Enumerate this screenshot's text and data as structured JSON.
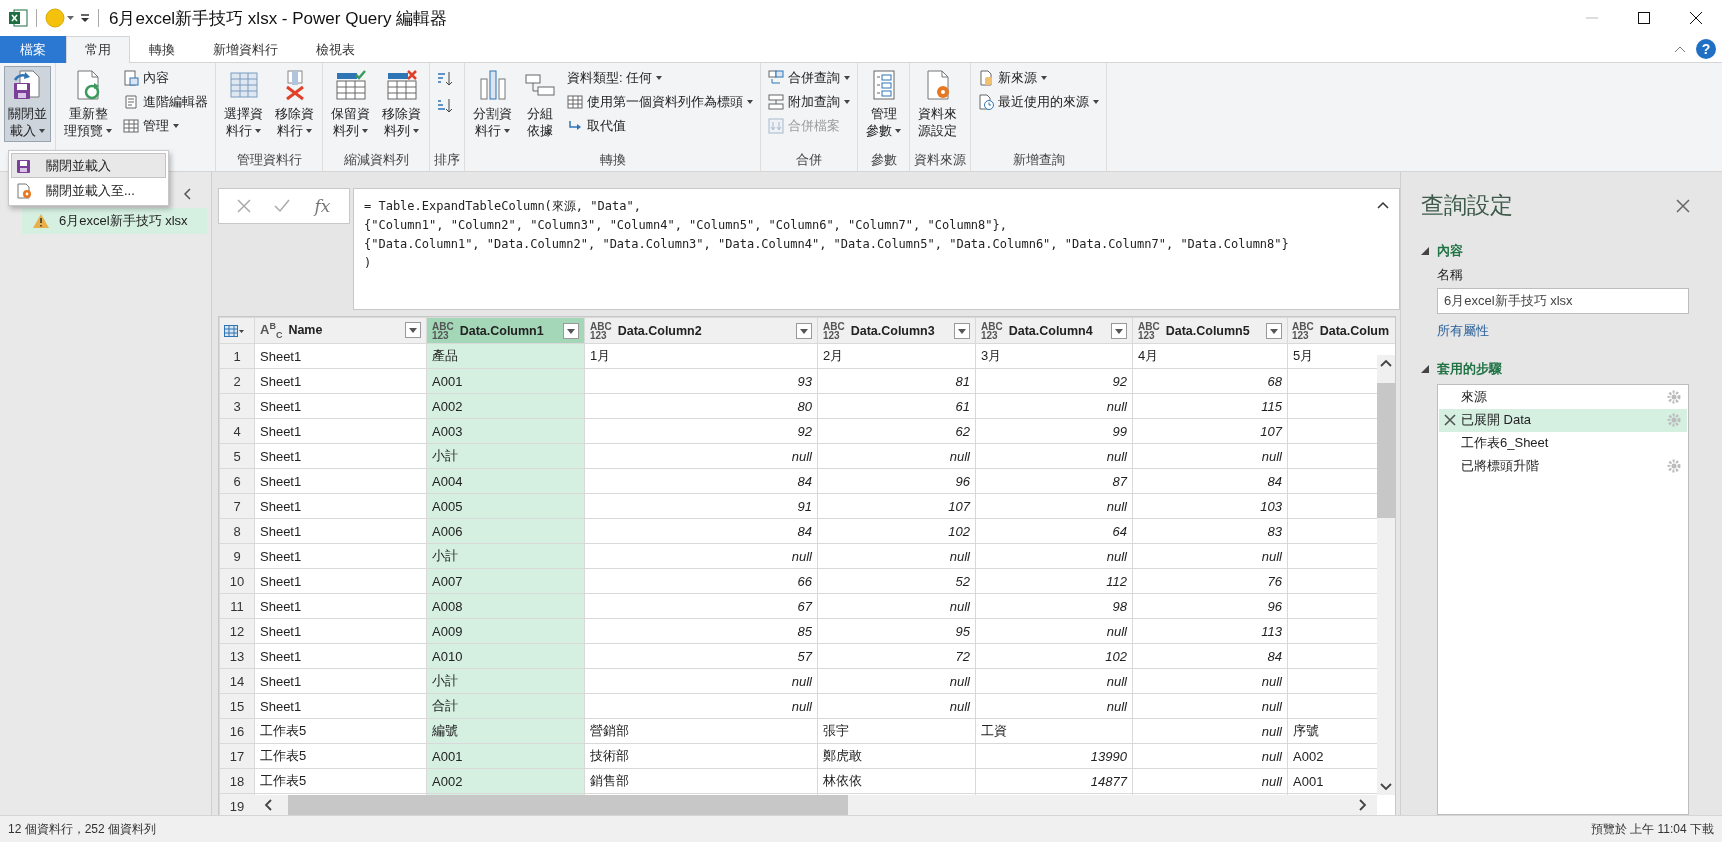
{
  "window": {
    "title": "6月excel新手技巧 xlsx - Power Query 編輯器"
  },
  "ribbon_tabs": [
    {
      "label": "檔案",
      "kind": "file",
      "selected": false
    },
    {
      "label": "常用",
      "kind": "tab",
      "selected": true
    },
    {
      "label": "轉換",
      "kind": "tab",
      "selected": false
    },
    {
      "label": "新增資料行",
      "kind": "tab",
      "selected": false
    },
    {
      "label": "檢視表",
      "kind": "tab",
      "selected": false
    }
  ],
  "help": "?",
  "ribbon_groups": [
    {
      "items": [
        {
          "kind": "large",
          "lines": [
            "關閉並",
            "載入"
          ],
          "dropdown": true,
          "pressed": true
        }
      ]
    },
    {
      "items": [
        {
          "kind": "large",
          "lines": [
            "重新整",
            "理預覽"
          ],
          "dropdown": true,
          "pressed": false
        },
        {
          "kind": "small",
          "label": "內容",
          "dropdown": false,
          "disabled": false
        },
        {
          "kind": "small",
          "label": "進階編輯器",
          "dropdown": false,
          "disabled": false
        },
        {
          "kind": "small",
          "label": "管理",
          "dropdown": true,
          "disabled": false
        }
      ]
    },
    {
      "label": "管理資料行",
      "items": [
        {
          "kind": "large",
          "lines": [
            "選擇資",
            "料行"
          ],
          "dropdown": true,
          "pressed": false
        },
        {
          "kind": "large",
          "lines": [
            "移除資",
            "料行"
          ],
          "dropdown": true,
          "pressed": false
        }
      ]
    },
    {
      "label": "縮減資料列",
      "items": [
        {
          "kind": "large",
          "lines": [
            "保留資",
            "料列"
          ],
          "dropdown": true,
          "pressed": false
        },
        {
          "kind": "large",
          "lines": [
            "移除資",
            "料列"
          ],
          "dropdown": true,
          "pressed": false
        }
      ]
    },
    {
      "label": "排序",
      "items": [
        {
          "kind": "icon"
        },
        {
          "kind": "icon"
        }
      ]
    },
    {
      "label": "轉換",
      "items": [
        {
          "kind": "large",
          "lines": [
            "分割資",
            "料行"
          ],
          "dropdown": true,
          "pressed": false
        },
        {
          "kind": "large",
          "lines": [
            "分組",
            "依據"
          ],
          "dropdown": false,
          "pressed": false
        },
        {
          "kind": "small",
          "label": "資料類型: 任何",
          "dropdown": true,
          "disabled": false
        },
        {
          "kind": "small",
          "label": "使用第一個資料列作為標頭",
          "dropdown": true,
          "disabled": false
        },
        {
          "kind": "small",
          "label": "取代值",
          "dropdown": false,
          "disabled": false
        }
      ]
    },
    {
      "label": "合併",
      "items": [
        {
          "kind": "small",
          "label": "合併查詢",
          "dropdown": true,
          "disabled": false
        },
        {
          "kind": "small",
          "label": "附加查詢",
          "dropdown": true,
          "disabled": false
        },
        {
          "kind": "small",
          "label": "合併檔案",
          "dropdown": false,
          "disabled": true
        }
      ]
    },
    {
      "label": "參數",
      "items": [
        {
          "kind": "large",
          "lines": [
            "管理",
            "參數"
          ],
          "dropdown": true,
          "pressed": false
        }
      ]
    },
    {
      "label": "資料來源",
      "items": [
        {
          "kind": "large",
          "lines": [
            "資料來",
            "源設定"
          ],
          "dropdown": false,
          "pressed": false
        }
      ]
    },
    {
      "label": "新增查詢",
      "items": [
        {
          "kind": "small",
          "label": "新來源",
          "dropdown": true,
          "disabled": false
        },
        {
          "kind": "small",
          "label": "最近使用的來源",
          "dropdown": true,
          "disabled": false
        }
      ]
    }
  ],
  "dropdown_menu": {
    "items": [
      {
        "label": "關閉並載入",
        "selected": true
      },
      {
        "label": "關閉並載入至...",
        "selected": false
      }
    ]
  },
  "queries": {
    "items": [
      {
        "label": "6月excel新手技巧 xlsx",
        "warning": true,
        "selected": true
      }
    ]
  },
  "formula_bar": {
    "fx": "fx",
    "lines": [
      "= Table.ExpandTableColumn(來源, \"Data\",",
      "{\"Column1\", \"Column2\", \"Column3\", \"Column4\", \"Column5\", \"Column6\", \"Column7\", \"Column8\"},",
      "{\"Data.Column1\", \"Data.Column2\", \"Data.Column3\", \"Data.Column4\", \"Data.Column5\", \"Data.Column6\", \"Data.Column7\", \"Data.Column8\"}",
      ")"
    ]
  },
  "grid": {
    "columns": [
      {
        "name": "Name",
        "type_icon": [
          "A$^{B}$$_{C}$"
        ],
        "filter": true,
        "selected": false
      },
      {
        "name": "Data.Column1",
        "type_icon": [
          "ABC",
          "123"
        ],
        "filter": true,
        "selected": true
      },
      {
        "name": "Data.Column2",
        "type_icon": [
          "ABC",
          "123"
        ],
        "filter": true,
        "selected": false
      },
      {
        "name": "Data.Column3",
        "type_icon": [
          "ABC",
          "123"
        ],
        "filter": true,
        "selected": false
      },
      {
        "name": "Data.Column4",
        "type_icon": [
          "ABC",
          "123"
        ],
        "filter": true,
        "selected": false
      },
      {
        "name": "Data.Column5",
        "type_icon": [
          "ABC",
          "123"
        ],
        "filter": true,
        "selected": false
      },
      {
        "name": "Data.Colum",
        "type_icon": [
          "ABC",
          "123"
        ],
        "filter": false,
        "selected": false
      }
    ],
    "rows": [
      {
        "number": "1",
        "cells": [
          {
            "text": "Sheet1",
            "kind": "text"
          },
          {
            "text": "產品",
            "kind": "text"
          },
          {
            "text": "1月",
            "kind": "text"
          },
          {
            "text": "2月",
            "kind": "text"
          },
          {
            "text": "3月",
            "kind": "text"
          },
          {
            "text": "4月",
            "kind": "text"
          },
          {
            "text": "5月",
            "kind": "text"
          }
        ]
      },
      {
        "number": "2",
        "cells": [
          {
            "text": "Sheet1",
            "kind": "text"
          },
          {
            "text": "A001",
            "kind": "text"
          },
          {
            "text": "93",
            "kind": "number"
          },
          {
            "text": "81",
            "kind": "number"
          },
          {
            "text": "92",
            "kind": "number"
          },
          {
            "text": "68",
            "kind": "number"
          }
        ]
      },
      {
        "number": "3",
        "cells": [
          {
            "text": "Sheet1",
            "kind": "text"
          },
          {
            "text": "A002",
            "kind": "text"
          },
          {
            "text": "80",
            "kind": "number"
          },
          {
            "text": "61",
            "kind": "number"
          },
          {
            "text": "null",
            "kind": "number"
          },
          {
            "text": "115",
            "kind": "number"
          }
        ]
      },
      {
        "number": "4",
        "cells": [
          {
            "text": "Sheet1",
            "kind": "text"
          },
          {
            "text": "A003",
            "kind": "text"
          },
          {
            "text": "92",
            "kind": "number"
          },
          {
            "text": "62",
            "kind": "number"
          },
          {
            "text": "99",
            "kind": "number"
          },
          {
            "text": "107",
            "kind": "number"
          }
        ]
      },
      {
        "number": "5",
        "cells": [
          {
            "text": "Sheet1",
            "kind": "text"
          },
          {
            "text": "小計",
            "kind": "text"
          },
          {
            "text": "null",
            "kind": "number"
          },
          {
            "text": "null",
            "kind": "number"
          },
          {
            "text": "null",
            "kind": "number"
          },
          {
            "text": "null",
            "kind": "number"
          }
        ]
      },
      {
        "number": "6",
        "cells": [
          {
            "text": "Sheet1",
            "kind": "text"
          },
          {
            "text": "A004",
            "kind": "text"
          },
          {
            "text": "84",
            "kind": "number"
          },
          {
            "text": "96",
            "kind": "number"
          },
          {
            "text": "87",
            "kind": "number"
          },
          {
            "text": "84",
            "kind": "number"
          }
        ]
      },
      {
        "number": "7",
        "cells": [
          {
            "text": "Sheet1",
            "kind": "text"
          },
          {
            "text": "A005",
            "kind": "text"
          },
          {
            "text": "91",
            "kind": "number"
          },
          {
            "text": "107",
            "kind": "number"
          },
          {
            "text": "null",
            "kind": "number"
          },
          {
            "text": "103",
            "kind": "number"
          }
        ]
      },
      {
        "number": "8",
        "cells": [
          {
            "text": "Sheet1",
            "kind": "text"
          },
          {
            "text": "A006",
            "kind": "text"
          },
          {
            "text": "84",
            "kind": "number"
          },
          {
            "text": "102",
            "kind": "number"
          },
          {
            "text": "64",
            "kind": "number"
          },
          {
            "text": "83",
            "kind": "number"
          }
        ]
      },
      {
        "number": "9",
        "cells": [
          {
            "text": "Sheet1",
            "kind": "text"
          },
          {
            "text": "小計",
            "kind": "text"
          },
          {
            "text": "null",
            "kind": "number"
          },
          {
            "text": "null",
            "kind": "number"
          },
          {
            "text": "null",
            "kind": "number"
          },
          {
            "text": "null",
            "kind": "number"
          }
        ]
      },
      {
        "number": "10",
        "cells": [
          {
            "text": "Sheet1",
            "kind": "text"
          },
          {
            "text": "A007",
            "kind": "text"
          },
          {
            "text": "66",
            "kind": "number"
          },
          {
            "text": "52",
            "kind": "number"
          },
          {
            "text": "112",
            "kind": "number"
          },
          {
            "text": "76",
            "kind": "number"
          }
        ]
      },
      {
        "number": "11",
        "cells": [
          {
            "text": "Sheet1",
            "kind": "text"
          },
          {
            "text": "A008",
            "kind": "text"
          },
          {
            "text": "67",
            "kind": "number"
          },
          {
            "text": "null",
            "kind": "number"
          },
          {
            "text": "98",
            "kind": "number"
          },
          {
            "text": "96",
            "kind": "number"
          }
        ]
      },
      {
        "number": "12",
        "cells": [
          {
            "text": "Sheet1",
            "kind": "text"
          },
          {
            "text": "A009",
            "kind": "text"
          },
          {
            "text": "85",
            "kind": "number"
          },
          {
            "text": "95",
            "kind": "number"
          },
          {
            "text": "null",
            "kind": "number"
          },
          {
            "text": "113",
            "kind": "number"
          }
        ]
      },
      {
        "number": "13",
        "cells": [
          {
            "text": "Sheet1",
            "kind": "text"
          },
          {
            "text": "A010",
            "kind": "text"
          },
          {
            "text": "57",
            "kind": "number"
          },
          {
            "text": "72",
            "kind": "number"
          },
          {
            "text": "102",
            "kind": "number"
          },
          {
            "text": "84",
            "kind": "number"
          }
        ]
      },
      {
        "number": "14",
        "cells": [
          {
            "text": "Sheet1",
            "kind": "text"
          },
          {
            "text": "小計",
            "kind": "text"
          },
          {
            "text": "null",
            "kind": "number"
          },
          {
            "text": "null",
            "kind": "number"
          },
          {
            "text": "null",
            "kind": "number"
          },
          {
            "text": "null",
            "kind": "number"
          }
        ]
      },
      {
        "number": "15",
        "cells": [
          {
            "text": "Sheet1",
            "kind": "text"
          },
          {
            "text": "合計",
            "kind": "text"
          },
          {
            "text": "null",
            "kind": "number"
          },
          {
            "text": "null",
            "kind": "number"
          },
          {
            "text": "null",
            "kind": "number"
          },
          {
            "text": "null",
            "kind": "number"
          }
        ]
      },
      {
        "number": "16",
        "cells": [
          {
            "text": "工作表5",
            "kind": "text"
          },
          {
            "text": "編號",
            "kind": "text"
          },
          {
            "text": "營銷部",
            "kind": "text"
          },
          {
            "text": "張宇",
            "kind": "text"
          },
          {
            "text": "工資",
            "kind": "text"
          },
          {
            "text": "null",
            "kind": "number"
          },
          {
            "text": "序號",
            "kind": "text"
          }
        ]
      },
      {
        "number": "17",
        "cells": [
          {
            "text": "工作表5",
            "kind": "text"
          },
          {
            "text": "A001",
            "kind": "text"
          },
          {
            "text": "技術部",
            "kind": "text"
          },
          {
            "text": "鄭虎敢",
            "kind": "text"
          },
          {
            "text": "13990",
            "kind": "number"
          },
          {
            "text": "null",
            "kind": "number"
          },
          {
            "text": "A002",
            "kind": "text"
          }
        ]
      },
      {
        "number": "18",
        "cells": [
          {
            "text": "工作表5",
            "kind": "text"
          },
          {
            "text": "A002",
            "kind": "text"
          },
          {
            "text": "銷售部",
            "kind": "text"
          },
          {
            "text": "林依依",
            "kind": "text"
          },
          {
            "text": "14877",
            "kind": "number"
          },
          {
            "text": "null",
            "kind": "number"
          },
          {
            "text": "A001",
            "kind": "text"
          }
        ]
      },
      {
        "number": "19"
      }
    ]
  },
  "query_settings": {
    "title": "查詢設定",
    "properties_heading": "內容",
    "name_label": "名稱",
    "name_value": "6月excel新手技巧 xlsx",
    "all_properties": "所有屬性",
    "steps_heading": "套用的步驟",
    "steps": [
      {
        "label": "來源",
        "selected": false,
        "settings": true
      },
      {
        "label": "已展開 Data",
        "selected": true,
        "settings": true
      },
      {
        "label": "工作表6_Sheet",
        "selected": false,
        "settings": false
      },
      {
        "label": "已將標頭升階",
        "selected": false,
        "settings": true
      }
    ]
  },
  "status_bar": {
    "left": "12 個資料行，252 個資料列",
    "right": "預覽於 上午 11:04 下載"
  }
}
